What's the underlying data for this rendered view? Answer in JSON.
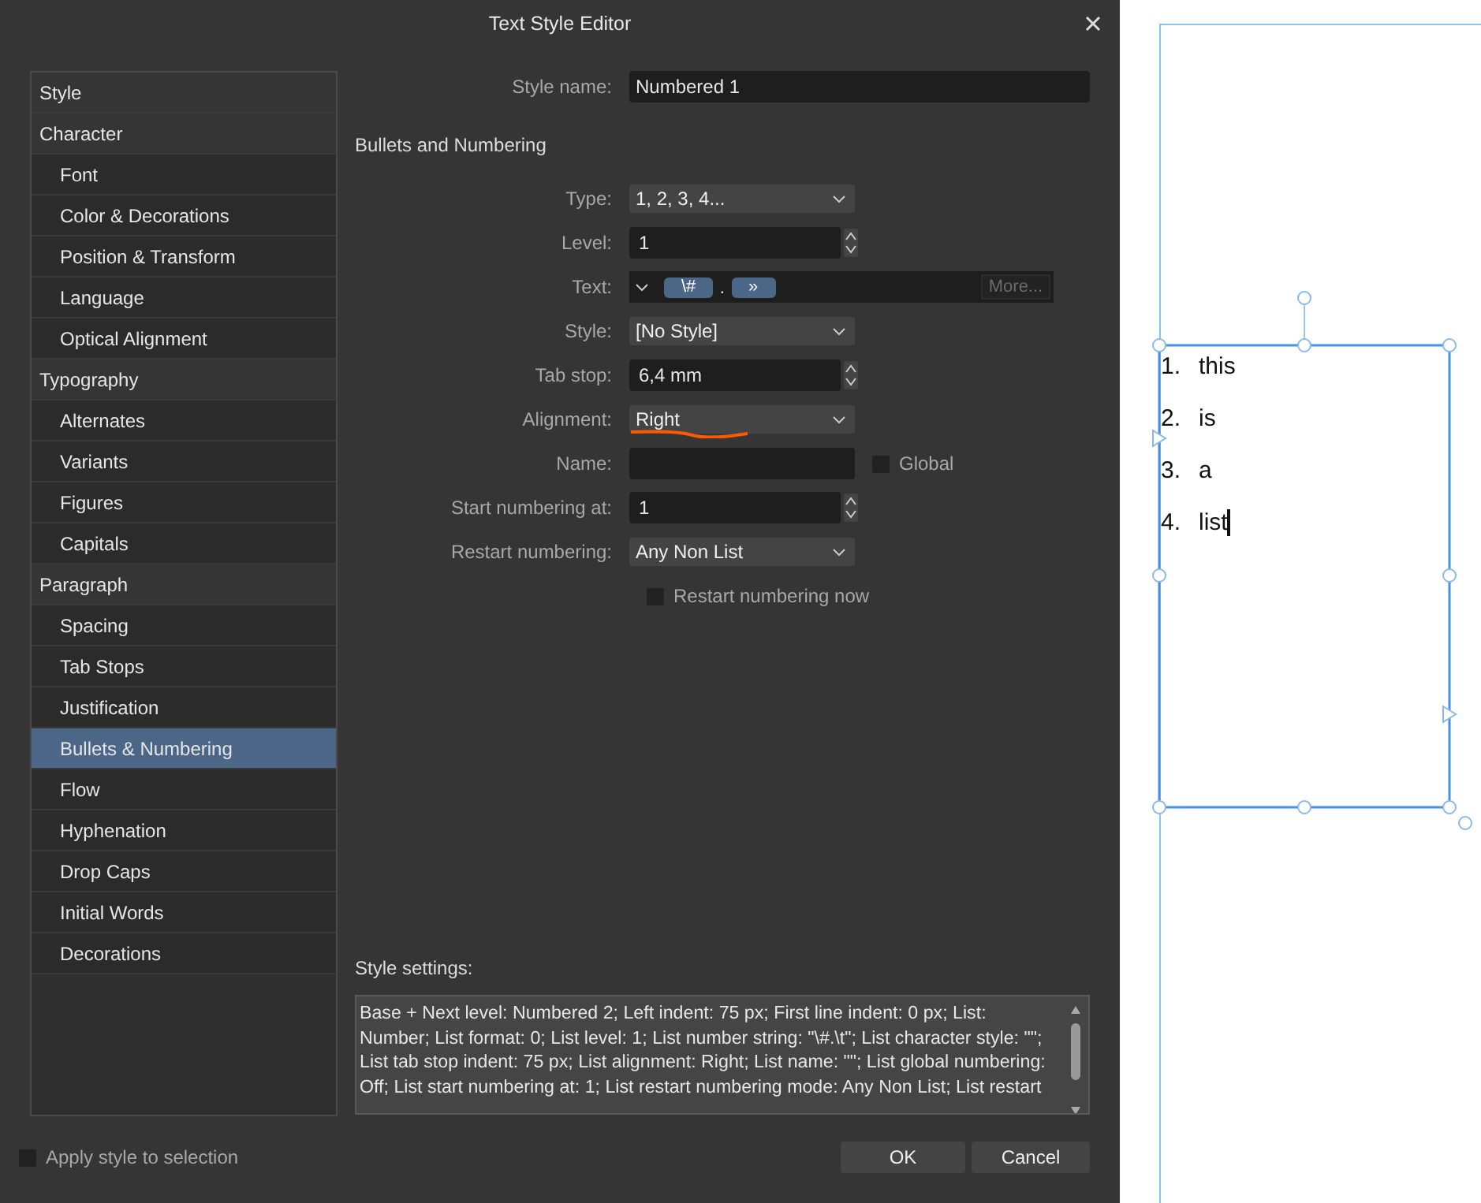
{
  "window": {
    "title": "Text Style Editor"
  },
  "sidebar": {
    "items": [
      {
        "label": "Style",
        "kind": "heading",
        "selected": false
      },
      {
        "label": "Character",
        "kind": "heading",
        "selected": false
      },
      {
        "label": "Font",
        "kind": "sub",
        "selected": false
      },
      {
        "label": "Color & Decorations",
        "kind": "sub",
        "selected": false
      },
      {
        "label": "Position & Transform",
        "kind": "sub",
        "selected": false
      },
      {
        "label": "Language",
        "kind": "sub",
        "selected": false
      },
      {
        "label": "Optical Alignment",
        "kind": "sub",
        "selected": false
      },
      {
        "label": "Typography",
        "kind": "heading",
        "selected": false
      },
      {
        "label": "Alternates",
        "kind": "sub",
        "selected": false
      },
      {
        "label": "Variants",
        "kind": "sub",
        "selected": false
      },
      {
        "label": "Figures",
        "kind": "sub",
        "selected": false
      },
      {
        "label": "Capitals",
        "kind": "sub",
        "selected": false
      },
      {
        "label": "Paragraph",
        "kind": "heading",
        "selected": false
      },
      {
        "label": "Spacing",
        "kind": "sub",
        "selected": false
      },
      {
        "label": "Tab Stops",
        "kind": "sub",
        "selected": false
      },
      {
        "label": "Justification",
        "kind": "sub",
        "selected": false
      },
      {
        "label": "Bullets & Numbering",
        "kind": "sub",
        "selected": true
      },
      {
        "label": "Flow",
        "kind": "sub",
        "selected": false
      },
      {
        "label": "Hyphenation",
        "kind": "sub",
        "selected": false
      },
      {
        "label": "Drop Caps",
        "kind": "sub",
        "selected": false
      },
      {
        "label": "Initial Words",
        "kind": "sub",
        "selected": false
      },
      {
        "label": "Decorations",
        "kind": "sub",
        "selected": false
      }
    ]
  },
  "style_name": {
    "label": "Style name:",
    "value": "Numbered 1"
  },
  "section_title": "Bullets and Numbering",
  "fields": [
    {
      "kind": "dropdown",
      "label": "Type:",
      "value": "1, 2, 3, 4..."
    },
    {
      "kind": "spinner",
      "label": "Level:",
      "value": "1"
    },
    {
      "kind": "tokens",
      "label": "Text:",
      "tokens": [
        {
          "kind": "chip",
          "text": "\\#"
        },
        {
          "kind": "plain",
          "text": "."
        },
        {
          "kind": "chip",
          "text": "»"
        }
      ],
      "button": {
        "label": "More...",
        "disabled": true
      }
    },
    {
      "kind": "dropdown",
      "label": "Style:",
      "value": "[No Style]"
    },
    {
      "kind": "spinner",
      "label": "Tab stop:",
      "value": "6,4 mm"
    },
    {
      "kind": "dropdown",
      "label": "Alignment:",
      "value": "Right",
      "underlined": true
    },
    {
      "kind": "input",
      "label": "Name:",
      "check": {
        "label": "Global",
        "checked": false
      }
    },
    {
      "kind": "spinner",
      "label": "Start numbering at:",
      "value": "1"
    },
    {
      "kind": "dropdown",
      "label": "Restart numbering:",
      "value": "Any Non List"
    },
    {
      "kind": "checkbox",
      "label": "Restart numbering now",
      "checked": false
    }
  ],
  "style_settings": {
    "label": "Style settings:",
    "text": "Base + Next level: Numbered 2; Left indent: 75 px; First line indent: 0 px; List: Number; List format: 0; List level: 1; List number string: \"\\#.\\t\"; List character style: \"\"; List tab stop indent: 75 px; List alignment: Right; List name: \"\"; List global numbering: Off; List start numbering at: 1; List restart numbering mode: Any Non List; List restart"
  },
  "apply_to_selection": {
    "label": "Apply style to selection",
    "checked": false
  },
  "buttons": [
    {
      "label": "OK"
    },
    {
      "label": "Cancel"
    }
  ],
  "canvas": {
    "list": [
      {
        "number": "1.",
        "text": "this"
      },
      {
        "number": "2.",
        "text": "is"
      },
      {
        "number": "3.",
        "text": "a"
      },
      {
        "number": "4.",
        "text": "list"
      }
    ]
  }
}
